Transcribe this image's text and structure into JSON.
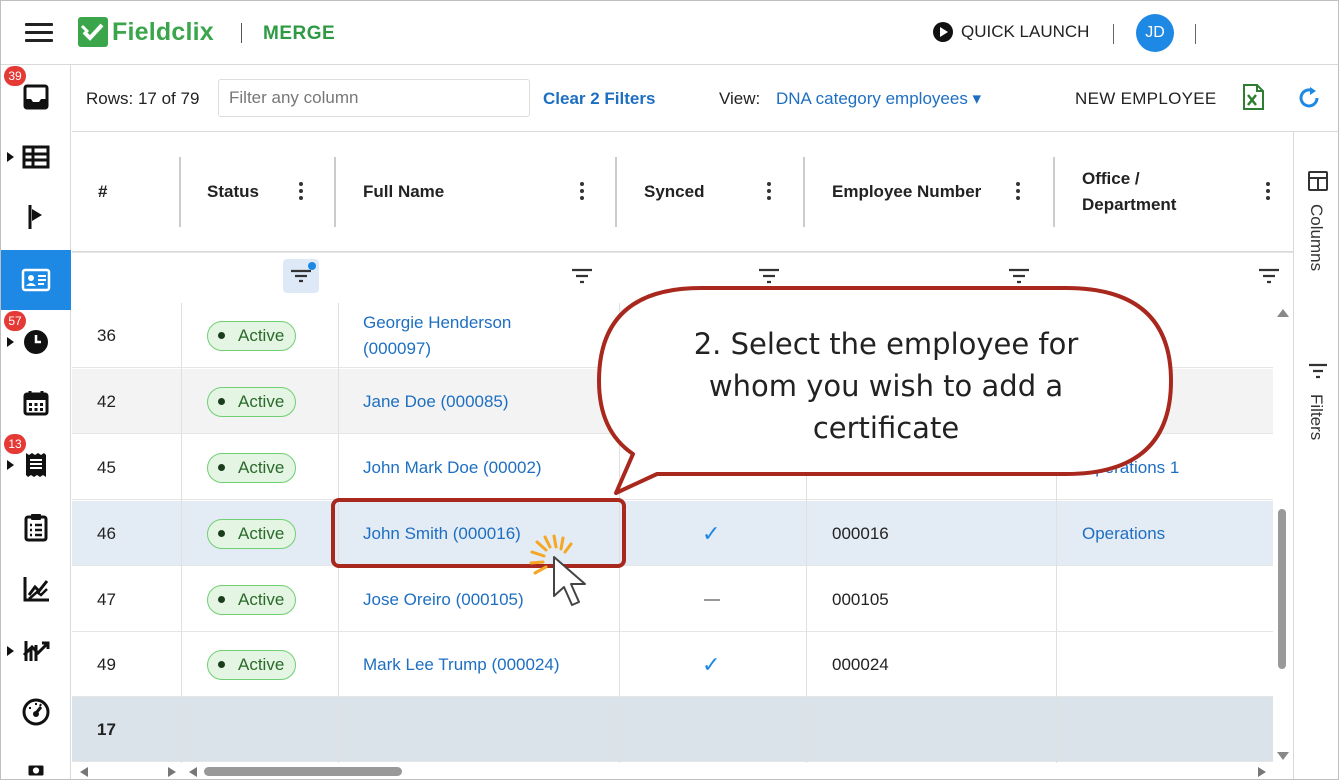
{
  "header": {
    "brand": "Fieldclix",
    "product": "MERGE",
    "quick_launch": "QUICK LAUNCH",
    "avatar_initials": "JD"
  },
  "sidebar": {
    "items": [
      {
        "icon": "inbox-icon",
        "badge": "39"
      },
      {
        "icon": "table-icon",
        "badge": ""
      },
      {
        "icon": "flag-icon",
        "badge": ""
      },
      {
        "icon": "id-card-icon",
        "badge": "",
        "active": true
      },
      {
        "icon": "clock-icon",
        "badge": "57"
      },
      {
        "icon": "calendar-icon",
        "badge": ""
      },
      {
        "icon": "receipt-icon",
        "badge": "13"
      },
      {
        "icon": "clipboard-icon",
        "badge": ""
      },
      {
        "icon": "chart-icon",
        "badge": ""
      },
      {
        "icon": "trend-icon",
        "badge": ""
      },
      {
        "icon": "gauge-icon",
        "badge": ""
      }
    ]
  },
  "toolbar": {
    "rows_label": "Rows: 17 of 79",
    "filter_placeholder": "Filter any column",
    "clear_filters": "Clear 2 Filters",
    "view_label": "View:",
    "view_value": "DNA category employees ▾",
    "new_employee": "NEW EMPLOYEE"
  },
  "grid": {
    "columns": [
      "#",
      "Status",
      "Full Name",
      "Synced",
      "Employee Number",
      "Office /",
      "Department"
    ],
    "rows": [
      {
        "num": "36",
        "status": "Active",
        "name_line1": "Georgie Henderson",
        "name_line2": "(000097)",
        "synced": "",
        "emp_no": "",
        "office": ""
      },
      {
        "num": "42",
        "status": "Active",
        "name_line1": "Jane Doe (000085)",
        "name_line2": "",
        "synced": "",
        "emp_no": "",
        "office": ""
      },
      {
        "num": "45",
        "status": "Active",
        "name_line1": "John Mark Doe (00002)",
        "name_line2": "",
        "synced": "",
        "emp_no": "",
        "office": "Operations 1"
      },
      {
        "num": "46",
        "status": "Active",
        "name_line1": "John Smith (000016)",
        "name_line2": "",
        "synced": "check",
        "emp_no": "000016",
        "office": "Operations"
      },
      {
        "num": "47",
        "status": "Active",
        "name_line1": "Jose Oreiro (000105)",
        "name_line2": "",
        "synced": "dash",
        "emp_no": "000105",
        "office": ""
      },
      {
        "num": "49",
        "status": "Active",
        "name_line1": "Mark Lee Trump (000024)",
        "name_line2": "",
        "synced": "check",
        "emp_no": "000024",
        "office": ""
      }
    ],
    "total_row_count": "17"
  },
  "side_panel": {
    "columns": "Columns",
    "filters": "Filters"
  },
  "callout": {
    "line1": "2. Select the employee for",
    "line2": "whom you wish to add a",
    "line3": "certificate"
  },
  "colors": {
    "brand_green": "#3aa54a",
    "accent_blue": "#1e88e5",
    "link_blue": "#1e6fc2",
    "callout_border": "#a8281e"
  }
}
